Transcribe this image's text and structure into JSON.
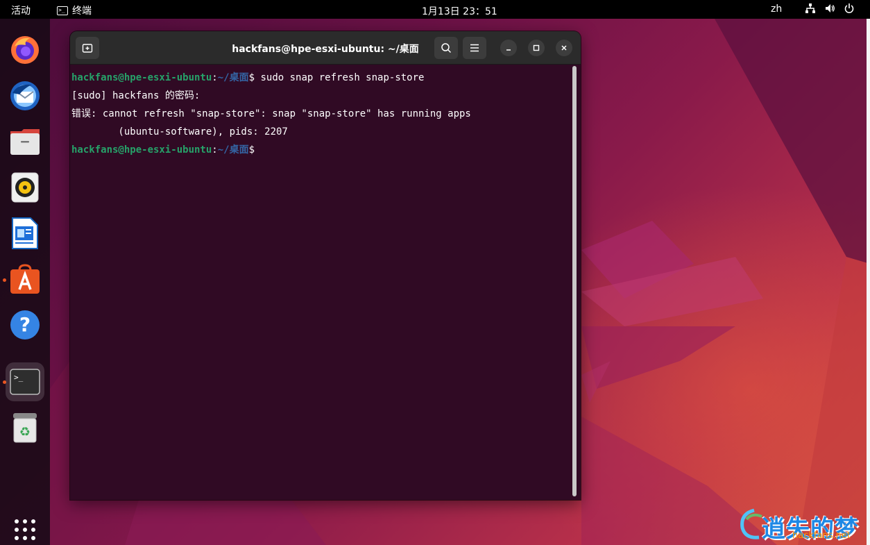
{
  "topbar": {
    "activities": "活动",
    "app_name": "终端",
    "clock": "1月13日  23：51",
    "language": "zh"
  },
  "dock": {
    "items": [
      {
        "name": "firefox",
        "icon": "firefox-icon"
      },
      {
        "name": "thunderbird",
        "icon": "thunderbird-icon"
      },
      {
        "name": "files",
        "icon": "files-icon"
      },
      {
        "name": "rhythmbox",
        "icon": "rhythmbox-icon"
      },
      {
        "name": "libreoffice-writer",
        "icon": "writer-icon"
      },
      {
        "name": "ubuntu-software",
        "icon": "software-icon",
        "running": true
      },
      {
        "name": "help",
        "icon": "help-icon"
      },
      {
        "name": "terminal",
        "icon": "terminal-icon",
        "running": true,
        "active": true
      },
      {
        "name": "trash",
        "icon": "trash-icon"
      }
    ],
    "show_apps_icon": "app-grid-icon"
  },
  "terminal": {
    "title": "hackfans@hpe-esxi-ubuntu: ~/桌面",
    "prompt_user": "hackfans@hpe-esxi-ubuntu",
    "prompt_sep": ":",
    "prompt_path": "~/桌面",
    "prompt_symbol": "$",
    "command": " sudo snap refresh snap-store",
    "output": [
      "[sudo] hackfans 的密码:",
      "错误: cannot refresh \"snap-store\": snap \"snap-store\" has running apps",
      "        (ubuntu-software), pids: 2207"
    ]
  },
  "watermark": {
    "text": "逍失的梦",
    "url": "hackfans.net"
  },
  "colors": {
    "terminal_bg": "#300a24",
    "prompt_user": "#26a269",
    "prompt_path": "#3465a4",
    "accent": "#e95420"
  }
}
